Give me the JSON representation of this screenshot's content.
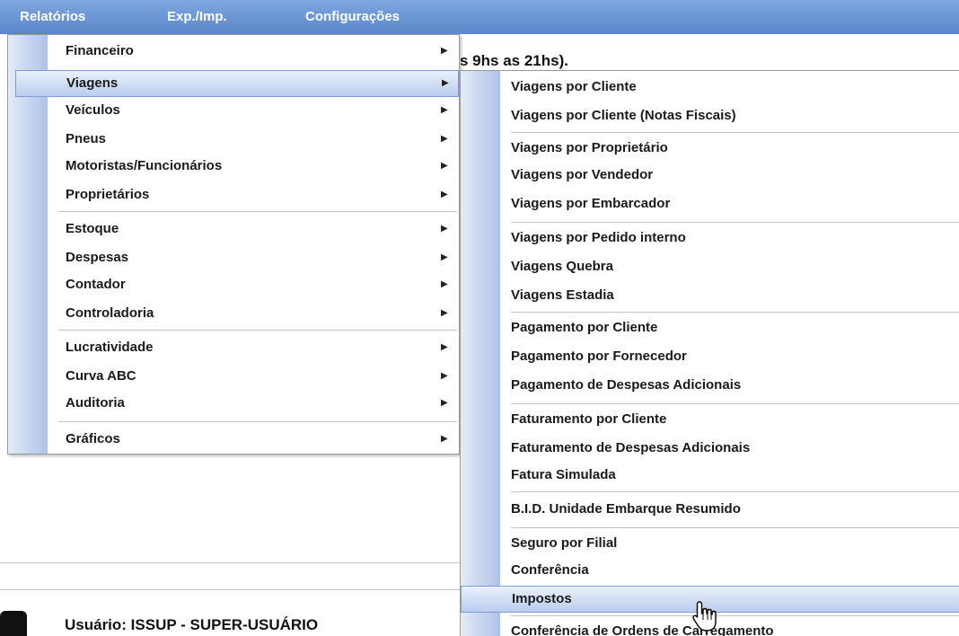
{
  "menubar": {
    "items": [
      "Relatórios",
      "Exp./Imp.",
      "Configurações"
    ]
  },
  "page": {
    "hours_text": "s 9hs as 21hs).",
    "user_text": "Usuário: ISSUP - SUPER-USUÁRIO"
  },
  "relatorios_menu": {
    "items": [
      {
        "label": "Financeiro"
      },
      {
        "label": "Viagens"
      },
      {
        "label": "Veículos"
      },
      {
        "label": "Pneus"
      },
      {
        "label": "Motoristas/Funcionários"
      },
      {
        "label": "Proprietários"
      },
      {
        "label": "Estoque"
      },
      {
        "label": "Despesas"
      },
      {
        "label": "Contador"
      },
      {
        "label": "Controladoria"
      },
      {
        "label": "Lucratividade"
      },
      {
        "label": "Curva ABC"
      },
      {
        "label": "Auditoria"
      },
      {
        "label": "Gráficos"
      }
    ],
    "highlighted": "Viagens",
    "submenu_arrow": "▶"
  },
  "viagens_menu": {
    "items": [
      {
        "label": "Viagens por Cliente"
      },
      {
        "label": "Viagens por Cliente (Notas Fiscais)"
      },
      {
        "label": "Viagens por Proprietário"
      },
      {
        "label": "Viagens por Vendedor"
      },
      {
        "label": "Viagens por Embarcador"
      },
      {
        "label": "Viagens por Pedido interno"
      },
      {
        "label": "Viagens Quebra"
      },
      {
        "label": "Viagens Estadia"
      },
      {
        "label": "Pagamento por Cliente"
      },
      {
        "label": "Pagamento por Fornecedor"
      },
      {
        "label": "Pagamento de Despesas Adicionais"
      },
      {
        "label": "Faturamento por Cliente"
      },
      {
        "label": "Faturamento de Despesas Adicionais"
      },
      {
        "label": "Fatura Simulada"
      },
      {
        "label": "B.I.D. Unidade Embarque Resumido"
      },
      {
        "label": "Seguro por Filial"
      },
      {
        "label": "Conferência"
      },
      {
        "label": "Impostos"
      },
      {
        "label": "Conferência de Ordens de Carregamento"
      }
    ],
    "highlighted": "Impostos"
  },
  "colors": {
    "menubar": "#5b86c9",
    "highlight_border": "#7f9dcf",
    "gutter": "#aec3e8"
  },
  "icons": {
    "cursor": "hand-pointer-icon",
    "submenu": "triangle-right-icon"
  }
}
